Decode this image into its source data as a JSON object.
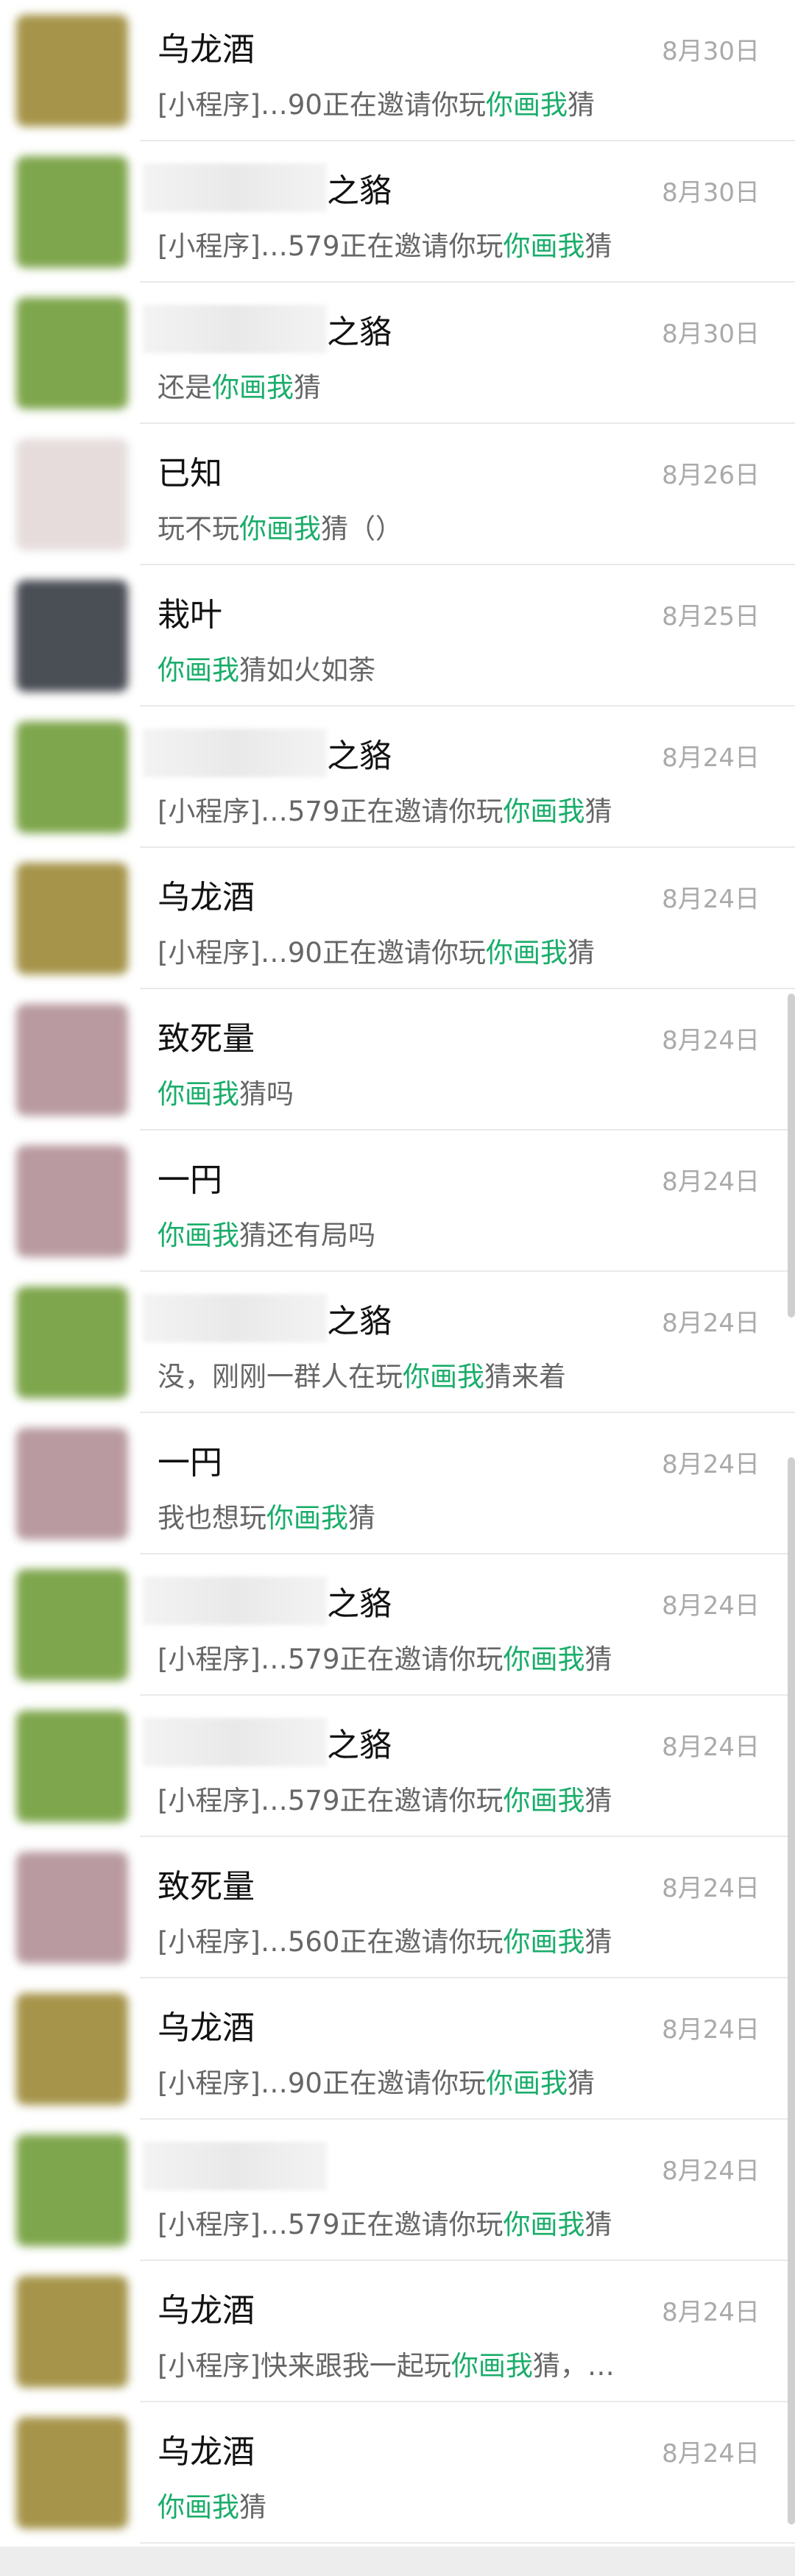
{
  "colors": {
    "highlight": "#1aad6a",
    "avatar_olive": "#a5944a",
    "avatar_green": "#7ea64c",
    "avatar_dark": "#4a4e55",
    "avatar_pink": "#b89aa0",
    "avatar_light": "#e6dcdc"
  },
  "chats": [
    {
      "name": "乌龙酒",
      "blurred": false,
      "avatar": "olive",
      "date": "8月30日",
      "msg_pre": "[小程序]…90正在邀请你玩",
      "msg_hl": "你画我",
      "msg_post": "猜"
    },
    {
      "name": "之貉",
      "blurred": true,
      "avatar": "green",
      "date": "8月30日",
      "msg_pre": "[小程序]…579正在邀请你玩",
      "msg_hl": "你画我",
      "msg_post": "猜"
    },
    {
      "name": "之貉",
      "blurred": true,
      "avatar": "green",
      "date": "8月30日",
      "msg_pre": "还是",
      "msg_hl": "你画我",
      "msg_post": "猜"
    },
    {
      "name": "已知",
      "blurred": false,
      "avatar": "light",
      "date": "8月26日",
      "msg_pre": "玩不玩",
      "msg_hl": "你画我",
      "msg_post": "猜（）"
    },
    {
      "name": "栽叶",
      "blurred": false,
      "avatar": "dark",
      "date": "8月25日",
      "msg_pre": "",
      "msg_hl": "你画我",
      "msg_post": "猜如火如荼"
    },
    {
      "name": "之貉",
      "blurred": true,
      "avatar": "green",
      "date": "8月24日",
      "msg_pre": "[小程序]…579正在邀请你玩",
      "msg_hl": "你画我",
      "msg_post": "猜"
    },
    {
      "name": "乌龙酒",
      "blurred": false,
      "avatar": "olive",
      "date": "8月24日",
      "msg_pre": "[小程序]…90正在邀请你玩",
      "msg_hl": "你画我",
      "msg_post": "猜"
    },
    {
      "name": "致死量",
      "blurred": false,
      "avatar": "pink",
      "date": "8月24日",
      "msg_pre": "",
      "msg_hl": "你画我",
      "msg_post": "猜吗"
    },
    {
      "name": "一円",
      "blurred": false,
      "avatar": "pink",
      "date": "8月24日",
      "msg_pre": "",
      "msg_hl": "你画我",
      "msg_post": "猜还有局吗"
    },
    {
      "name": "之貉",
      "blurred": true,
      "avatar": "green",
      "date": "8月24日",
      "msg_pre": "没，刚刚一群人在玩",
      "msg_hl": "你画我",
      "msg_post": "猜来着"
    },
    {
      "name": "一円",
      "blurred": false,
      "avatar": "pink",
      "date": "8月24日",
      "msg_pre": "我也想玩",
      "msg_hl": "你画我",
      "msg_post": "猜"
    },
    {
      "name": "之貉",
      "blurred": true,
      "avatar": "green",
      "date": "8月24日",
      "msg_pre": "[小程序]…579正在邀请你玩",
      "msg_hl": "你画我",
      "msg_post": "猜"
    },
    {
      "name": "之貉",
      "blurred": true,
      "avatar": "green",
      "date": "8月24日",
      "msg_pre": "[小程序]…579正在邀请你玩",
      "msg_hl": "你画我",
      "msg_post": "猜"
    },
    {
      "name": "致死量",
      "blurred": false,
      "avatar": "pink",
      "date": "8月24日",
      "msg_pre": "[小程序]…560正在邀请你玩",
      "msg_hl": "你画我",
      "msg_post": "猜"
    },
    {
      "name": "乌龙酒",
      "blurred": false,
      "avatar": "olive",
      "date": "8月24日",
      "msg_pre": "[小程序]…90正在邀请你玩",
      "msg_hl": "你画我",
      "msg_post": "猜"
    },
    {
      "name": "",
      "blurred": true,
      "avatar": "green",
      "date": "8月24日",
      "msg_pre": "[小程序]…579正在邀请你玩",
      "msg_hl": "你画我",
      "msg_post": "猜"
    },
    {
      "name": "乌龙酒",
      "blurred": false,
      "avatar": "olive",
      "date": "8月24日",
      "msg_pre": "[小程序]快来跟我一起玩",
      "msg_hl": "你画我",
      "msg_post": "猜，…"
    },
    {
      "name": "乌龙酒",
      "blurred": false,
      "avatar": "olive",
      "date": "8月24日",
      "msg_pre": "",
      "msg_hl": "你画我",
      "msg_post": "猜"
    }
  ]
}
